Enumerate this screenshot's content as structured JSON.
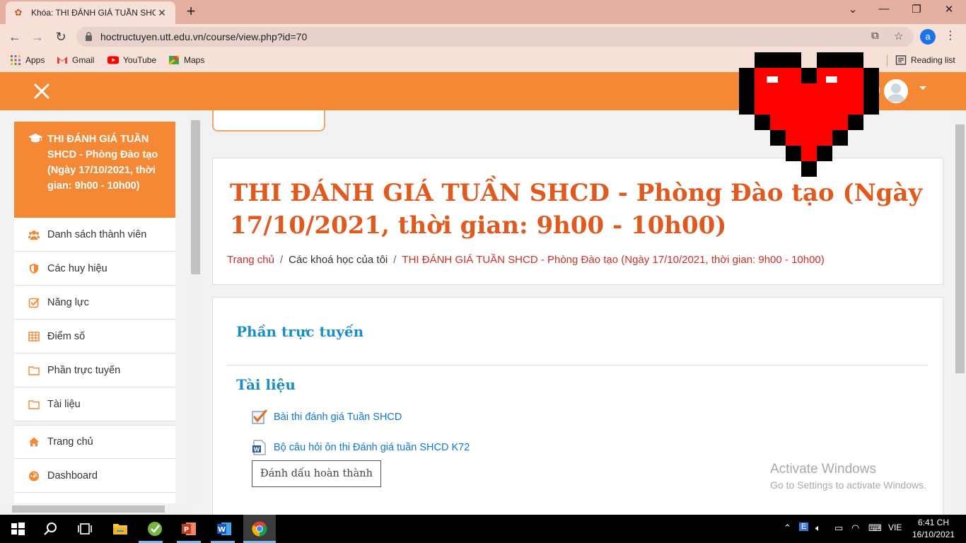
{
  "browser": {
    "tab_title": "Khóa: THI ĐÁNH GIÁ TUẦN SHCD",
    "url": "hoctructuyen.utt.edu.vn/course/view.php?id=70",
    "profile_initial": "a",
    "bookmarks": [
      "Apps",
      "Gmail",
      "YouTube",
      "Maps"
    ],
    "reading_list": "Reading list"
  },
  "navbar": {
    "user_fragment": "n"
  },
  "drawer": {
    "course_title": "THI ĐÁNH GIÁ TUẦN SHCD - Phòng Đào tạo (Ngày 17/10/2021, thời gian: 9h00 - 10h00)",
    "items": [
      {
        "label": "Danh sách thành viên",
        "icon": "users-icon"
      },
      {
        "label": "Các huy hiệu",
        "icon": "shield-icon"
      },
      {
        "label": "Năng lực",
        "icon": "checkbox-icon"
      },
      {
        "label": "Điểm số",
        "icon": "table-icon"
      },
      {
        "label": "Phần trực tuyến",
        "icon": "folder-icon"
      },
      {
        "label": "Tài liệu",
        "icon": "folder-icon"
      }
    ],
    "items2": [
      {
        "label": "Trang chủ",
        "icon": "home-icon"
      },
      {
        "label": "Dashboard",
        "icon": "dashboard-icon"
      }
    ]
  },
  "main": {
    "page_title": "THI ĐÁNH GIÁ TUẦN SHCD - Phòng Đào tạo (Ngày 17/10/2021, thời gian: 9h00 - 10h00)",
    "breadcrumb": {
      "home": "Trang chủ",
      "my_courses": "Các khoá học của tôi",
      "current": "THI ĐÁNH GIÁ TUẦN SHCD - Phòng Đào tạo (Ngày 17/10/2021, thời gian: 9h00 - 10h00)"
    },
    "sections": [
      "Phần trực tuyến",
      "Tài liệu"
    ],
    "activities": [
      {
        "label": "Bài thi đánh giá Tuần SHCD",
        "icon": "quiz-icon"
      },
      {
        "label": "Bộ câu hỏi ôn thi Đánh giá tuần SHCD K72",
        "icon": "word-document-icon"
      }
    ],
    "mark_done_button": "Đánh dấu hoàn thành",
    "watermark_title": "Activate Windows",
    "watermark_sub": "Go to Settings to activate Windows."
  },
  "taskbar": {
    "language": "VIE",
    "time": "6:41 CH",
    "date": "16/10/2021"
  },
  "colors": {
    "brand_orange": "#f58835",
    "title_orange": "#e05a1f",
    "section_blue": "#1a8fc7",
    "link_blue": "#1177d1",
    "breadcrumb_red": "#c9302c",
    "heart_red": "#ff0000"
  }
}
